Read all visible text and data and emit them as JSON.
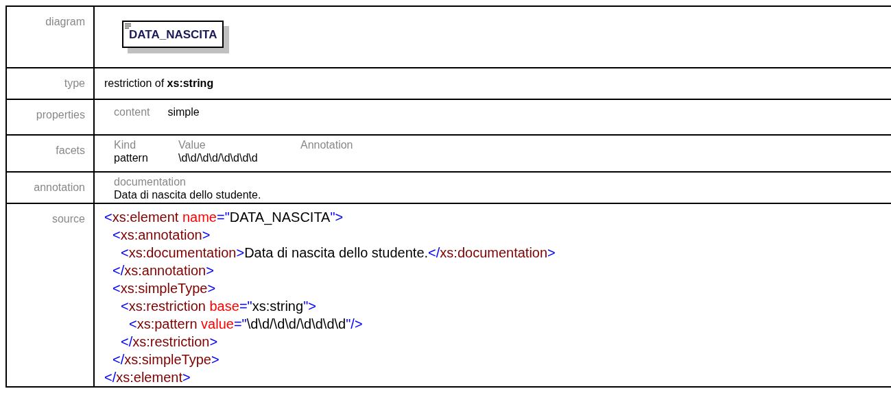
{
  "rows": [
    {
      "kind": "diagram",
      "label": "diagram",
      "element_name": "DATA_NASCITA"
    },
    {
      "kind": "type",
      "label": "type",
      "text": "restriction of **xs:string**"
    },
    {
      "kind": "properties",
      "label": "properties",
      "pairs": [
        {
          "key": "content",
          "value": "simple"
        }
      ]
    },
    {
      "kind": "facets",
      "label": "facets",
      "columns": [
        "Kind",
        "Value",
        "Annotation"
      ],
      "rows": [
        [
          "pattern",
          "\\d\\d/\\d\\d/\\d\\d\\d\\d",
          ""
        ]
      ]
    },
    {
      "kind": "annotation",
      "label": "annotation",
      "heading": "documentation",
      "text": "Data di nascita dello studente."
    },
    {
      "kind": "source",
      "label": "source",
      "tree": [
        {
          "open": [
            {
              "kind": "punct",
              "text": "<"
            },
            {
              "kind": "tag",
              "text": "xs:element "
            },
            {
              "kind": "attr",
              "text": "name"
            },
            {
              "kind": "punct",
              "text": "=\""
            },
            {
              "kind": "value",
              "text": "DATA_NASCITA"
            },
            {
              "kind": "punct",
              "text": "\">"
            }
          ],
          "children": [
            {
              "open": [
                {
                  "kind": "punct",
                  "text": "<"
                },
                {
                  "kind": "tag",
                  "text": "xs:annotation"
                },
                {
                  "kind": "punct",
                  "text": ">"
                }
              ],
              "children": [
                {
                  "open": [
                    {
                      "kind": "punct",
                      "text": "<"
                    },
                    {
                      "kind": "tag",
                      "text": "xs:documentation"
                    },
                    {
                      "kind": "punct",
                      "text": ">"
                    },
                    {
                      "kind": "value",
                      "text": "Data di nascita dello studente."
                    },
                    {
                      "kind": "punct",
                      "text": "</"
                    },
                    {
                      "kind": "tag",
                      "text": "xs:documentation"
                    },
                    {
                      "kind": "punct",
                      "text": ">"
                    }
                  ]
                }
              ],
              "close": [
                {
                  "kind": "punct",
                  "text": "</"
                },
                {
                  "kind": "tag",
                  "text": "xs:annotation"
                },
                {
                  "kind": "punct",
                  "text": ">"
                }
              ]
            },
            {
              "open": [
                {
                  "kind": "punct",
                  "text": "<"
                },
                {
                  "kind": "tag",
                  "text": "xs:simpleType"
                },
                {
                  "kind": "punct",
                  "text": ">"
                }
              ],
              "children": [
                {
                  "open": [
                    {
                      "kind": "punct",
                      "text": "<"
                    },
                    {
                      "kind": "tag",
                      "text": "xs:restriction "
                    },
                    {
                      "kind": "attr",
                      "text": "base"
                    },
                    {
                      "kind": "punct",
                      "text": "=\""
                    },
                    {
                      "kind": "value",
                      "text": "xs:string"
                    },
                    {
                      "kind": "punct",
                      "text": "\">"
                    }
                  ],
                  "children": [
                    {
                      "open": [
                        {
                          "kind": "punct",
                          "text": "<"
                        },
                        {
                          "kind": "tag",
                          "text": "xs:pattern "
                        },
                        {
                          "kind": "attr",
                          "text": "value"
                        },
                        {
                          "kind": "punct",
                          "text": "=\""
                        },
                        {
                          "kind": "value",
                          "text": "\\d\\d/\\d\\d/\\d\\d\\d\\d"
                        },
                        {
                          "kind": "punct",
                          "text": "\"/>"
                        }
                      ]
                    }
                  ],
                  "close": [
                    {
                      "kind": "punct",
                      "text": "</"
                    },
                    {
                      "kind": "tag",
                      "text": "xs:restriction"
                    },
                    {
                      "kind": "punct",
                      "text": ">"
                    }
                  ]
                }
              ],
              "close": [
                {
                  "kind": "punct",
                  "text": "</"
                },
                {
                  "kind": "tag",
                  "text": "xs:simpleType"
                },
                {
                  "kind": "punct",
                  "text": ">"
                }
              ]
            }
          ],
          "close": [
            {
              "kind": "punct",
              "text": "</"
            },
            {
              "kind": "tag",
              "text": "xs:element"
            },
            {
              "kind": "punct",
              "text": ">"
            }
          ]
        }
      ]
    }
  ]
}
